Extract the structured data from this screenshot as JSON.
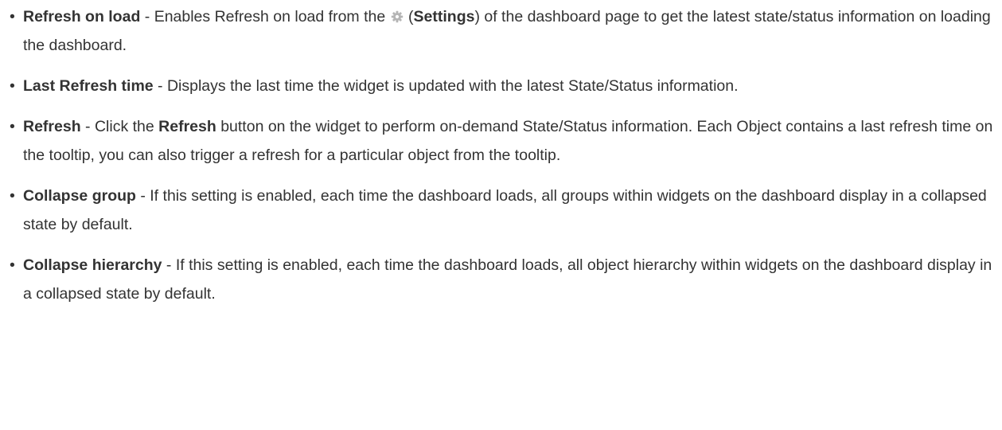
{
  "bullet_char": "•",
  "items": [
    {
      "term": "Refresh on load",
      "text_a": " - Enables Refresh on load from the ",
      "icon": "gear-icon",
      "text_b": " (",
      "bold_b": "Settings",
      "text_c": ") of the dashboard page to get the latest state/status information on loading the dashboard."
    },
    {
      "term": "Last Refresh time",
      "text_a": " - Displays the last time the widget is updated with the latest State/Status information."
    },
    {
      "term": "Refresh",
      "text_a": " - Click the ",
      "bold_b": "Refresh",
      "text_c": " button on the widget to perform on-demand State/Status information. Each Object contains a last refresh time on the tooltip, you can also trigger a refresh for a particular object from the tooltip."
    },
    {
      "term": "Collapse group",
      "text_a": " - If this setting is enabled, each time the dashboard loads, all groups within widgets on the dashboard display in a collapsed state by default."
    },
    {
      "term": "Collapse hierarchy",
      "text_a": " - If this setting is enabled, each time the dashboard loads, all object hierarchy within widgets on the dashboard display in a collapsed state by default."
    }
  ],
  "colors": {
    "text": "#333333",
    "gear": "#b5b5b5"
  }
}
